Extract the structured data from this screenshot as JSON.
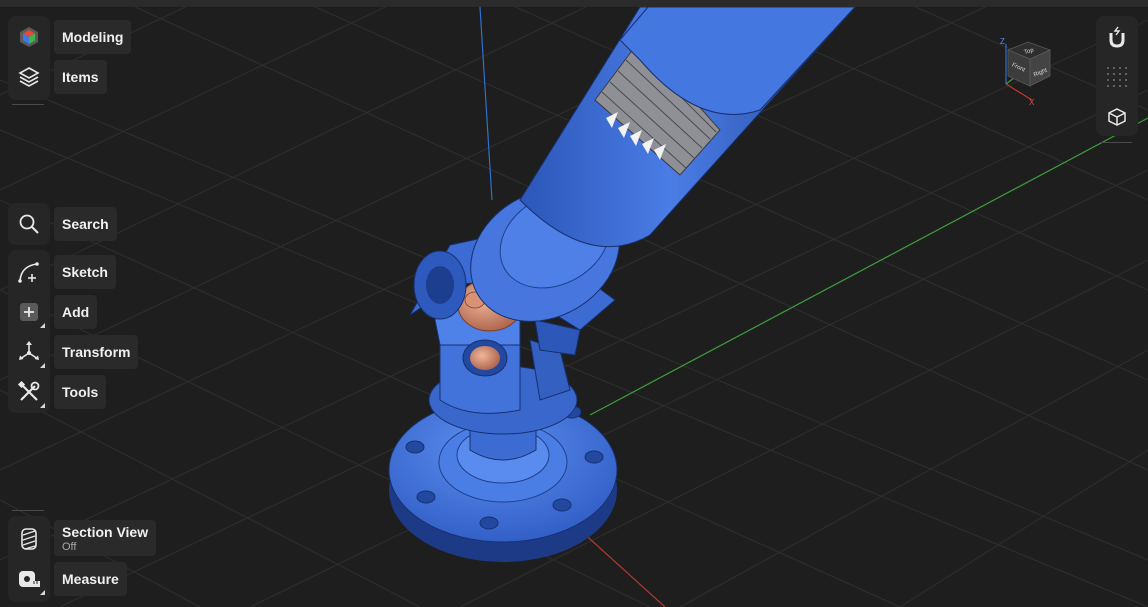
{
  "toolbar_left": {
    "modeling_label": "Modeling",
    "items_label": "Items",
    "search_label": "Search",
    "sketch_label": "Sketch",
    "add_label": "Add",
    "transform_label": "Transform",
    "tools_label": "Tools",
    "section_view_label": "Section View",
    "section_view_state": "Off",
    "measure_label": "Measure"
  },
  "view_cube": {
    "top_face": "Top",
    "front_face": "Front",
    "right_face": "Right",
    "axis_z": "Z",
    "axis_x": "X"
  },
  "toolbar_right": {
    "icons": [
      "snap-magnet-icon",
      "grid-icon",
      "view-cube-icon"
    ]
  },
  "colors": {
    "background": "#1e1e1e",
    "grid_line": "#2e2e2e",
    "axis_x": "#b0392b",
    "axis_y": "#3f9e3a",
    "axis_z": "#2f6fd0",
    "model_blue": "#3f6fd6",
    "model_copper": "#c9866b",
    "panel": "#262626",
    "label_bg": "#2a2a2a"
  }
}
